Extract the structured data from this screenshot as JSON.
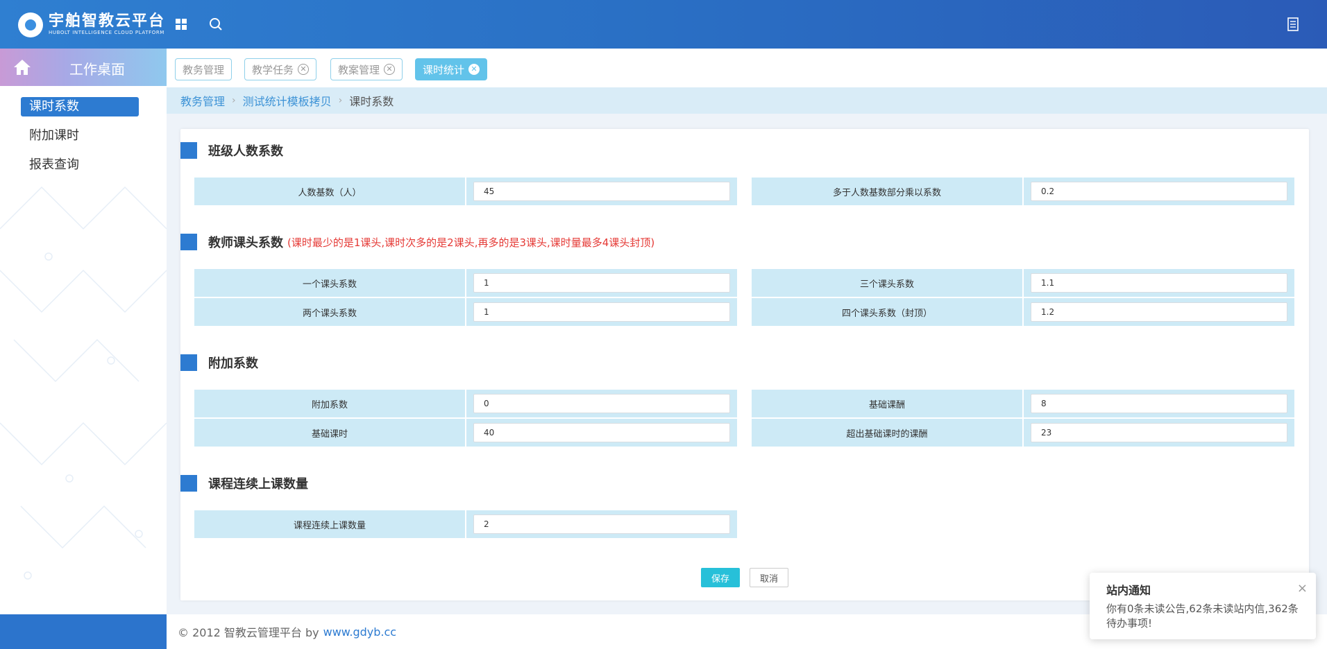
{
  "header": {
    "logo_cn": "宇舶智教云平台",
    "logo_en": "HUBOLT INTELLIGENCE CLOUD PLATFORM"
  },
  "sidebar": {
    "home_label": "工作桌面",
    "items": [
      {
        "label": "课时系数"
      },
      {
        "label": "附加课时"
      },
      {
        "label": "报表查询"
      }
    ]
  },
  "tabs": [
    {
      "label": "教务管理"
    },
    {
      "label": "教学任务"
    },
    {
      "label": "教案管理"
    },
    {
      "label": "课时统计"
    }
  ],
  "breadcrumb": {
    "level1": "教务管理",
    "level2": "测试统计模板拷贝",
    "current": "课时系数"
  },
  "sections": {
    "class_size": {
      "title": "班级人数系数",
      "fields": [
        {
          "label": "人数基数（人）",
          "value": "45"
        },
        {
          "label": "多于人数基数部分乘以系数",
          "value": "0.2"
        }
      ]
    },
    "teacher": {
      "title": "教师课头系数",
      "note": "(课时最少的是1课头,课时次多的是2课头,再多的是3课头,课时量最多4课头封顶)",
      "fields": [
        {
          "label": "一个课头系数",
          "value": "1"
        },
        {
          "label": "三个课头系数",
          "value": "1.1"
        },
        {
          "label": "两个课头系数",
          "value": "1"
        },
        {
          "label": "四个课头系数（封顶）",
          "value": "1.2"
        }
      ]
    },
    "extra": {
      "title": "附加系数",
      "fields": [
        {
          "label": "附加系数",
          "value": "0"
        },
        {
          "label": "基础课酬",
          "value": "8"
        },
        {
          "label": "基础课时",
          "value": "40"
        },
        {
          "label": "超出基础课时的课酬",
          "value": "23"
        }
      ]
    },
    "continuous": {
      "title": "课程连续上课数量",
      "fields": [
        {
          "label": "课程连续上课数量",
          "value": "2"
        }
      ]
    }
  },
  "buttons": {
    "save": "保存",
    "cancel": "取消"
  },
  "footer": {
    "copyright": "© 2012 智教云管理平台 by",
    "link": "www.gdyb.cc"
  },
  "notification": {
    "title": "站内通知",
    "body": "你有0条未读公告,62条未读站内信,362条待办事项!",
    "close": "×"
  },
  "colors": {
    "header_blue": "#2a6fc4",
    "accent_blue": "#2d7bd1",
    "tab_active": "#62c3ea",
    "label_bg": "#cdeaf6",
    "save_button": "#27c0d9",
    "note_red": "#e53935"
  }
}
